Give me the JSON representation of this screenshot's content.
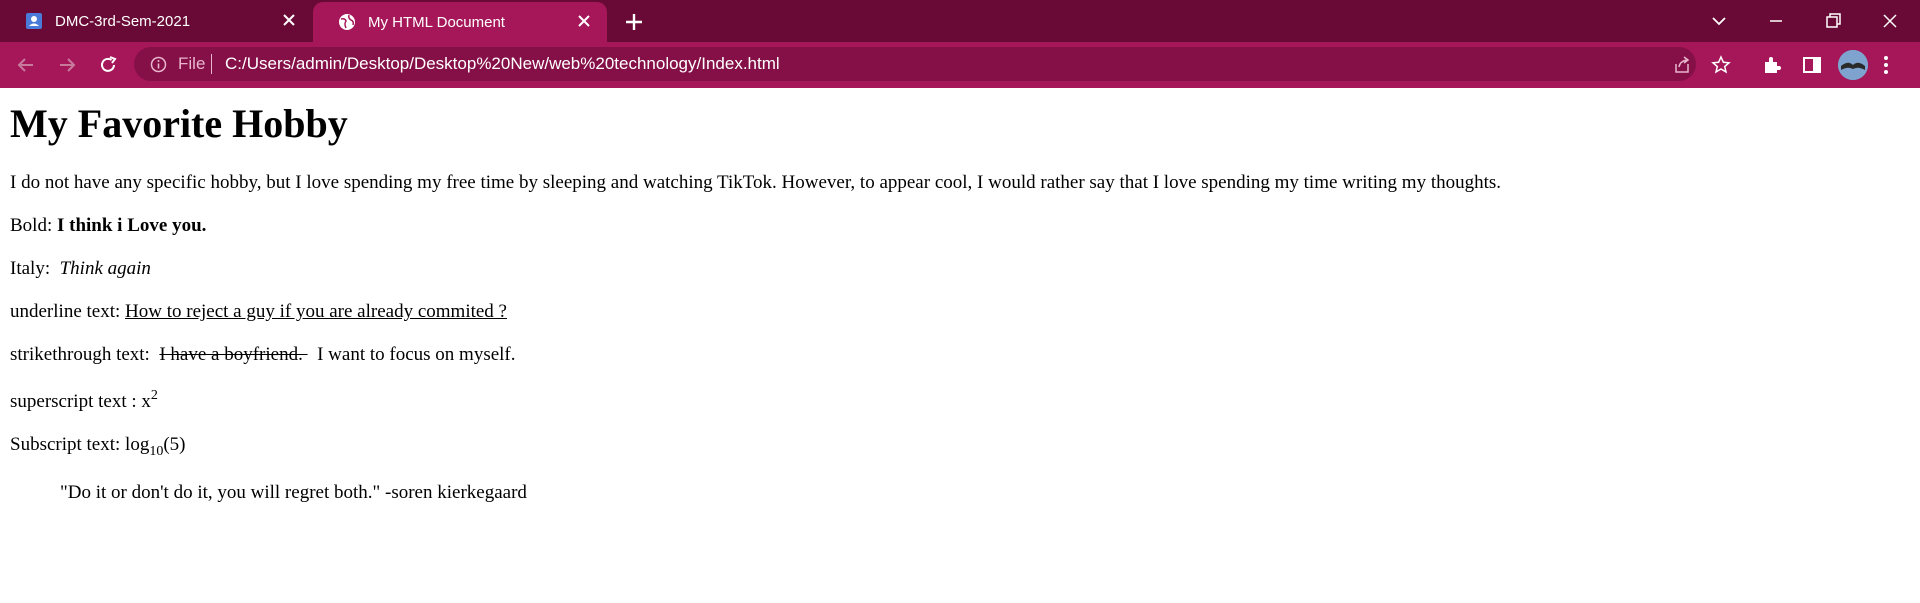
{
  "browser": {
    "tabs": [
      {
        "label": "DMC-3rd-Sem-2021",
        "active": false,
        "icon": "account-icon"
      },
      {
        "label": "My HTML Document",
        "active": true,
        "icon": "globe-icon"
      }
    ],
    "address": {
      "scheme_label": "File",
      "url": "C:/Users/admin/Desktop/Desktop%20New/web%20technology/Index.html"
    },
    "colors": {
      "frame": "#680a35",
      "toolbar": "#a51759",
      "omnibox": "#850f47",
      "active_tab": "#a51759"
    }
  },
  "page": {
    "heading": "My Favorite Hobby",
    "intro": "I do not have any specific hobby, but I love spending my free time by sleeping and watching TikTok. However, to appear cool, I would rather say that I love spending my time writing my thoughts.",
    "bold_label": "Bold: ",
    "bold_text": "I think i Love you.",
    "italic_label": "Italy: ",
    "italic_text": "Think again",
    "underline_label": "underline text: ",
    "underline_text": "How to reject a guy if you are already commited ?",
    "strike_label": "strikethrough text: ",
    "strike_text": "I have a boyfriend. ",
    "strike_after": " I want to focus on myself.",
    "superscript_label": "superscript text : x",
    "superscript_value": "2",
    "subscript_label": "Subscript text: log",
    "subscript_value": "10",
    "subscript_after": "(5)",
    "quote": "\"Do it or don't do it, you will regret both.\" -soren kierkegaard"
  }
}
